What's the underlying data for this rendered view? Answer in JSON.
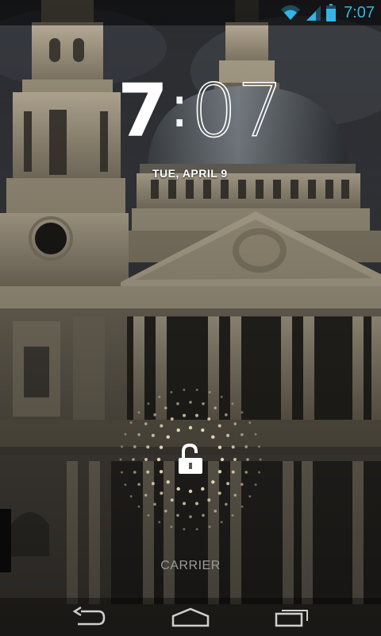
{
  "status_bar": {
    "time": "7:07",
    "wifi_icon": "wifi-icon",
    "signal_icon": "cell-signal-icon",
    "battery_icon": "battery-icon",
    "accent_color": "#33b5e5"
  },
  "lockscreen": {
    "clock": {
      "hour": "7",
      "separator": ":",
      "minutes": "07"
    },
    "date": "TUE, APRIL 9",
    "unlock_icon": "unlock-padlock-icon",
    "carrier": "CARRIER"
  },
  "nav_bar": {
    "back_icon": "back-icon",
    "home_icon": "home-icon",
    "recents_icon": "recent-apps-icon"
  }
}
